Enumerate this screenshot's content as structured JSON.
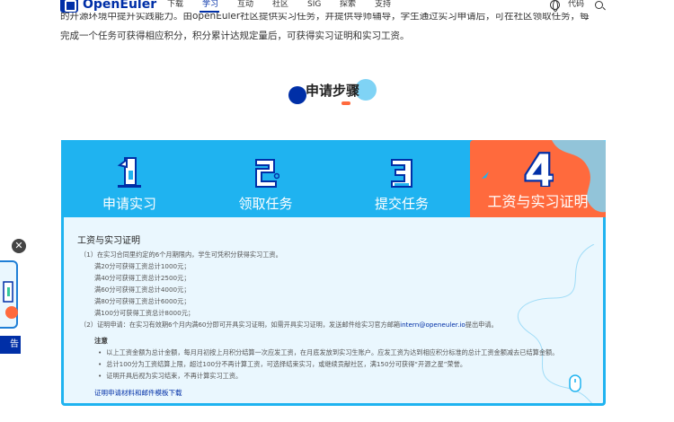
{
  "nav": {
    "brand": "OpenEuler",
    "items": [
      "下载",
      "学习",
      "互动",
      "社区",
      "SIG",
      "探索",
      "支持"
    ],
    "active_index": 1,
    "code_label": "代码",
    "icons": {
      "language": "globe-icon",
      "search": "search-icon"
    }
  },
  "intro": {
    "line1": "的开源环境中提升实践能力。由openEuler社区提供实习任务，并提供导师辅导，学生通过实习申请后，可在社区领取任务，每",
    "line2": "完成一个任务可获得相应积分，积分累计达规定量后，可获得实习证明和实习工资。"
  },
  "section": {
    "title": "申请步骤"
  },
  "steps": [
    {
      "label": "申请实习",
      "number": "1"
    },
    {
      "label": "领取任务",
      "number": "2"
    },
    {
      "label": "提交任务",
      "number": "3"
    },
    {
      "label": "工资与实习证明",
      "number": "4"
    }
  ],
  "active_step": 3,
  "panel": {
    "title": "工资与实习证明",
    "item1": "（1）在实习合同里约定的6个月期限内，学生可凭积分获得实习工资。",
    "tiers": [
      "满20分可获得工资总计1000元；",
      "满40分可获得工资总计2500元；",
      "满60分可获得工资总计4000元；",
      "满80分可获得工资总计6000元；",
      "满100分可获得工资总计8000元；"
    ],
    "item2_prefix": "（2）证明申请：在实习有效期6个月内满60分即可开具实习证明，如需开具实习证明，发送邮件给实习官方邮箱",
    "item2_email": "intern@openeuler.io",
    "item2_suffix": "提出申请。",
    "note_title": "注意",
    "notes": [
      "以上工资金额为总计金额，每月月初按上月积分结算一次应发工资，在月底发放到实习生账户。应发工资为达到相应积分标准的总计工资金额减去已结算金额。",
      "总计100分为工资结算上限，超过100分不再计算工资，可选择结束实习，或继续贡献社区，满150分可获得“开源之星”荣誉。",
      "证明开具后视为实习结束，不再计算实习工资。"
    ],
    "download_link": "证明申请材料和邮件模板下载"
  },
  "float_widget": {
    "close_symbol": "✕",
    "tab_text": "告"
  },
  "colors": {
    "brand": "#002fa7",
    "step_bar": "#1fb3f0",
    "active_step": "#ff6a3d",
    "panel_bg": "#eaf7fe"
  }
}
